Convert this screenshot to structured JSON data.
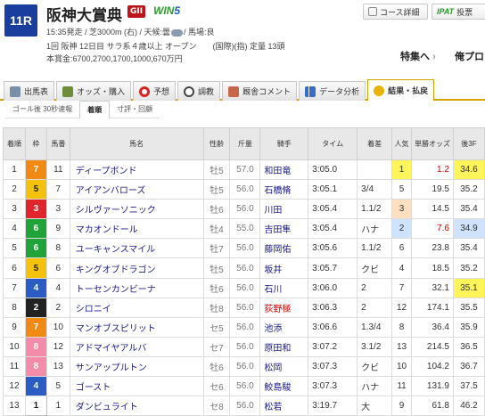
{
  "header": {
    "race_no": "11R",
    "title": "阪神大賞典",
    "grade": "GII",
    "win5_a": "WIN",
    "win5_b": "5",
    "line1": "15:35発走 / 芝3000m (右) / 天候:曇",
    "line1b": "/ 馬場:良",
    "line2": "1回 阪神 12日目 サラ系４歳以上 オープン　　(国際)(指) 定量 13頭",
    "line3": "本賞金:6700,2700,1700,1000,670万円",
    "btn_course": "コース詳細",
    "btn_ipat_logo": "IPAT",
    "btn_ipat": "投票",
    "tokushu": "特集へ",
    "oremai": "俺プロ"
  },
  "tabs": [
    "出馬表",
    "オッズ・購入",
    "予想",
    "調教",
    "厩舎コメント",
    "データ分析",
    "結果・払戻"
  ],
  "subtabs": [
    "ゴール後 30秒速報",
    "着順",
    "寸評・回顧"
  ],
  "columns": [
    "着順",
    "枠",
    "馬番",
    "馬名",
    "性齢",
    "斤量",
    "騎手",
    "タイム",
    "着差",
    "人気",
    "単勝オッズ",
    "後3F"
  ],
  "rows": [
    {
      "pos": "1",
      "waku": "7",
      "num": "11",
      "horse": "ディープボンド",
      "sexage": "牡5",
      "weight": "57.0",
      "jockey": "和田竜",
      "time": "3:05.0",
      "margin": "",
      "pop": "1",
      "odds": "1.2",
      "last3f": "34.6"
    },
    {
      "pos": "2",
      "waku": "5",
      "num": "7",
      "horse": "アイアンバローズ",
      "sexage": "牡5",
      "weight": "56.0",
      "jockey": "石橋脩",
      "time": "3:05.1",
      "margin": "3/4",
      "pop": "5",
      "odds": "19.5",
      "last3f": "35.2"
    },
    {
      "pos": "3",
      "waku": "3",
      "num": "3",
      "horse": "シルヴァーソニック",
      "sexage": "牡6",
      "weight": "56.0",
      "jockey": "川田",
      "time": "3:05.4",
      "margin": "1.1/2",
      "pop": "3",
      "odds": "14.5",
      "last3f": "35.4"
    },
    {
      "pos": "4",
      "waku": "6",
      "num": "9",
      "horse": "マカオンドール",
      "sexage": "牡4",
      "weight": "55.0",
      "jockey": "吉田隼",
      "time": "3:05.4",
      "margin": "ハナ",
      "pop": "2",
      "odds": "7.6",
      "last3f": "34.9"
    },
    {
      "pos": "5",
      "waku": "6",
      "num": "8",
      "horse": "ユーキャンスマイル",
      "sexage": "牡7",
      "weight": "56.0",
      "jockey": "藤岡佑",
      "time": "3:05.6",
      "margin": "1.1/2",
      "pop": "6",
      "odds": "23.8",
      "last3f": "35.4"
    },
    {
      "pos": "6",
      "waku": "5",
      "num": "6",
      "horse": "キングオブドラゴン",
      "sexage": "牡5",
      "weight": "56.0",
      "jockey": "坂井",
      "time": "3:05.7",
      "margin": "クビ",
      "pop": "4",
      "odds": "18.5",
      "last3f": "35.2"
    },
    {
      "pos": "7",
      "waku": "4",
      "num": "4",
      "horse": "トーセンカンビーナ",
      "sexage": "牡6",
      "weight": "56.0",
      "jockey": "石川",
      "time": "3:06.0",
      "margin": "2",
      "pop": "7",
      "odds": "32.1",
      "last3f": "35.1"
    },
    {
      "pos": "8",
      "waku": "2",
      "num": "2",
      "horse": "シロニイ",
      "sexage": "牡8",
      "weight": "56.0",
      "jockey": "荻野極",
      "time": "3:06.3",
      "margin": "2",
      "pop": "12",
      "odds": "174.1",
      "last3f": "35.5"
    },
    {
      "pos": "9",
      "waku": "7",
      "num": "10",
      "horse": "マンオブスピリット",
      "sexage": "セ5",
      "weight": "56.0",
      "jockey": "池添",
      "time": "3:06.6",
      "margin": "1.3/4",
      "pop": "8",
      "odds": "36.4",
      "last3f": "35.9"
    },
    {
      "pos": "10",
      "waku": "8",
      "num": "12",
      "horse": "アドマイヤアルバ",
      "sexage": "セ7",
      "weight": "56.0",
      "jockey": "原田和",
      "time": "3:07.2",
      "margin": "3.1/2",
      "pop": "13",
      "odds": "214.5",
      "last3f": "36.5"
    },
    {
      "pos": "11",
      "waku": "8",
      "num": "13",
      "horse": "サンアップルトン",
      "sexage": "牡6",
      "weight": "56.0",
      "jockey": "松岡",
      "time": "3:07.3",
      "margin": "クビ",
      "pop": "10",
      "odds": "104.2",
      "last3f": "36.7"
    },
    {
      "pos": "12",
      "waku": "4",
      "num": "5",
      "horse": "ゴースト",
      "sexage": "セ6",
      "weight": "56.0",
      "jockey": "鮫島駿",
      "time": "3:07.3",
      "margin": "ハナ",
      "pop": "11",
      "odds": "131.9",
      "last3f": "37.5"
    },
    {
      "pos": "13",
      "waku": "1",
      "num": "1",
      "horse": "ダンビュライト",
      "sexage": "セ8",
      "weight": "56.0",
      "jockey": "松若",
      "time": "3:19.7",
      "margin": "大",
      "pop": "9",
      "odds": "61.8",
      "last3f": "46.2"
    }
  ],
  "colors": {
    "waku": {
      "1": "#ffffff",
      "2": "#222222",
      "3": "#e0262c",
      "4": "#2a5cc4",
      "5": "#f4c20d",
      "6": "#22a33a",
      "7": "#f08a14",
      "8": "#f28ca8"
    },
    "accent": "#d8a000",
    "badge": "#1a3e9e"
  }
}
